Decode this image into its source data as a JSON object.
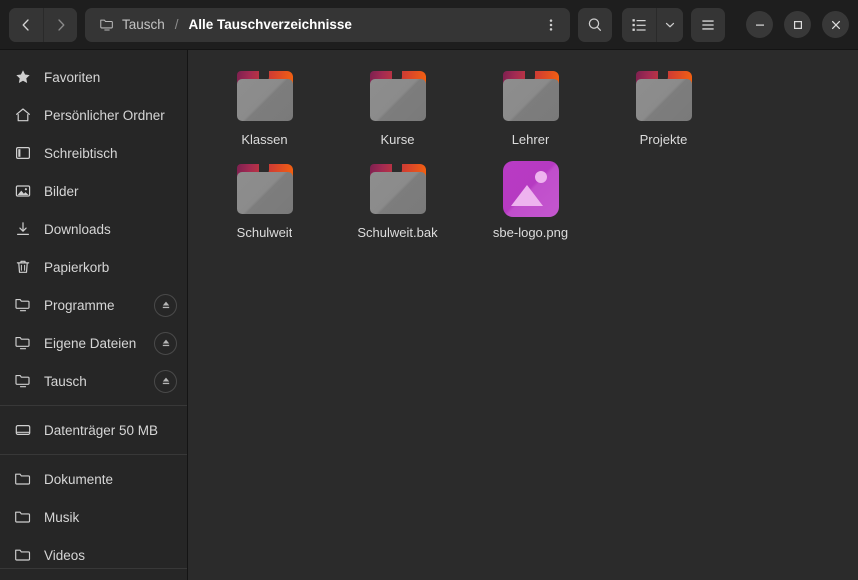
{
  "window": {
    "title": "Alle Tauschverzeichnisse"
  },
  "header": {
    "back_label": "Zurück",
    "forward_label": "Vor",
    "breadcrumb": {
      "root_icon": "network-folder-icon",
      "root_label": "Tausch",
      "separator": "/",
      "current_label": "Alle Tauschverzeichnisse"
    },
    "path_menu_label": "Pfadmenü",
    "search_label": "Suchen",
    "view_list_label": "Listenansicht",
    "view_options_label": "Ansichtsoptionen",
    "main_menu_label": "Hauptmenü",
    "minimize_label": "Minimieren",
    "maximize_label": "Maximieren",
    "close_label": "Schließen"
  },
  "sidebar": {
    "groups": [
      {
        "items": [
          {
            "icon": "star-icon",
            "label": "Favoriten",
            "eject": false
          },
          {
            "icon": "home-icon",
            "label": "Persönlicher Ordner",
            "eject": false
          },
          {
            "icon": "desktop-icon",
            "label": "Schreibtisch",
            "eject": false
          },
          {
            "icon": "image-icon",
            "label": "Bilder",
            "eject": false
          },
          {
            "icon": "download-icon",
            "label": "Downloads",
            "eject": false
          },
          {
            "icon": "trash-icon",
            "label": "Papierkorb",
            "eject": false
          },
          {
            "icon": "network-folder-icon",
            "label": "Programme",
            "eject": true
          },
          {
            "icon": "network-folder-icon",
            "label": "Eigene Dateien",
            "eject": true
          },
          {
            "icon": "network-folder-icon",
            "label": "Tausch",
            "eject": true
          }
        ]
      },
      {
        "items": [
          {
            "icon": "drive-icon",
            "label": "Datenträger 50 MB",
            "eject": false
          }
        ]
      },
      {
        "items": [
          {
            "icon": "folder-icon",
            "label": "Dokumente",
            "eject": false
          },
          {
            "icon": "folder-icon",
            "label": "Musik",
            "eject": false
          },
          {
            "icon": "folder-icon",
            "label": "Videos",
            "eject": false
          }
        ]
      }
    ],
    "eject_label": "Auswerfen"
  },
  "files": [
    {
      "name": "Klassen",
      "type": "folder"
    },
    {
      "name": "Kurse",
      "type": "folder"
    },
    {
      "name": "Lehrer",
      "type": "folder"
    },
    {
      "name": "Projekte",
      "type": "folder"
    },
    {
      "name": "Schulweit",
      "type": "folder"
    },
    {
      "name": "Schulweit.bak",
      "type": "folder"
    },
    {
      "name": "sbe-logo.png",
      "type": "image"
    }
  ],
  "colors": {
    "header_bg": "#1e1e1e",
    "sidebar_bg": "#262626",
    "content_bg": "#2b2b2b",
    "folder_body": "#8a8a8a",
    "folder_tab_start": "#7d2050",
    "folder_tab_end": "#f4630f",
    "image_icon": "#b93bc4",
    "text": "#d6d6d6"
  }
}
